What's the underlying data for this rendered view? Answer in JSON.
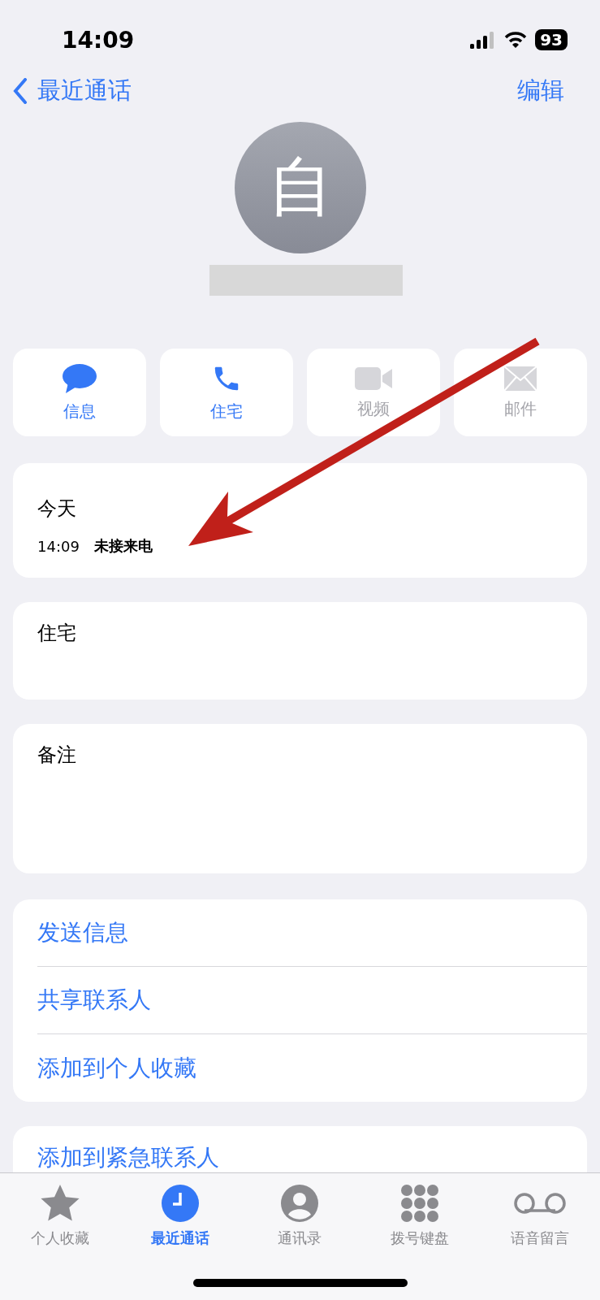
{
  "status_bar": {
    "time": "14:09",
    "battery": "93"
  },
  "nav": {
    "back": "最近通话",
    "edit": "编辑"
  },
  "avatar": {
    "initial": "自"
  },
  "actions": [
    {
      "kind": "message",
      "label": "信息",
      "disabled": false
    },
    {
      "kind": "phone",
      "label": "住宅",
      "disabled": false
    },
    {
      "kind": "video",
      "label": "视频",
      "disabled": true
    },
    {
      "kind": "mail",
      "label": "邮件",
      "disabled": true
    }
  ],
  "recent": {
    "day": "今天",
    "time": "14:09",
    "status": "未接来电"
  },
  "phone": {
    "label": "住宅"
  },
  "notes": {
    "label": "备注"
  },
  "links": [
    "发送信息",
    "共享联系人",
    "添加到个人收藏"
  ],
  "emergency": "添加到紧急联系人",
  "tabs": [
    {
      "kind": "star",
      "label": "个人收藏",
      "selected": false
    },
    {
      "kind": "clock",
      "label": "最近通话",
      "selected": true
    },
    {
      "kind": "person",
      "label": "通讯录",
      "selected": false
    },
    {
      "kind": "keypad",
      "label": "拨号键盘",
      "selected": false
    },
    {
      "kind": "voicemail",
      "label": "语音留言",
      "selected": false
    }
  ]
}
